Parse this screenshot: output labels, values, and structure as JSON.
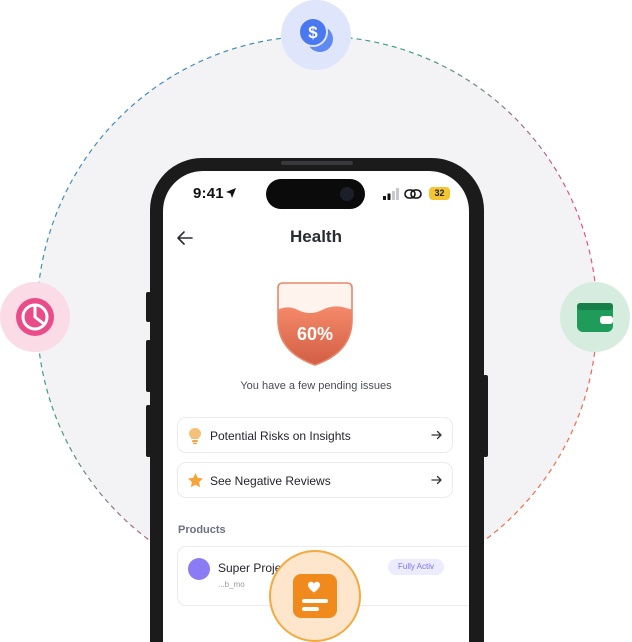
{
  "status_bar": {
    "time": "9:41",
    "battery": "32"
  },
  "header": {
    "title": "Health"
  },
  "health": {
    "percent_label": "60%",
    "percent": 60,
    "message": "You have a few pending issues"
  },
  "actions": [
    {
      "label": "Potential Risks on Insights",
      "icon": "lightbulb-icon"
    },
    {
      "label": "See Negative Reviews",
      "icon": "star-icon"
    }
  ],
  "products": {
    "title": "Products",
    "items": [
      {
        "name": "Super Proje",
        "subtitle": "...b_mo",
        "badge": "Fully Activ"
      }
    ]
  },
  "orbit_icons": [
    "dollar-coins-icon",
    "pie-chart-icon",
    "wallet-icon",
    "health-report-icon"
  ],
  "colors": {
    "accent_blue": "#4a78f0",
    "accent_pink": "#ea4c89",
    "accent_green": "#1f9b5a",
    "accent_orange": "#f08a1d",
    "health_fill": "#e16a52"
  }
}
